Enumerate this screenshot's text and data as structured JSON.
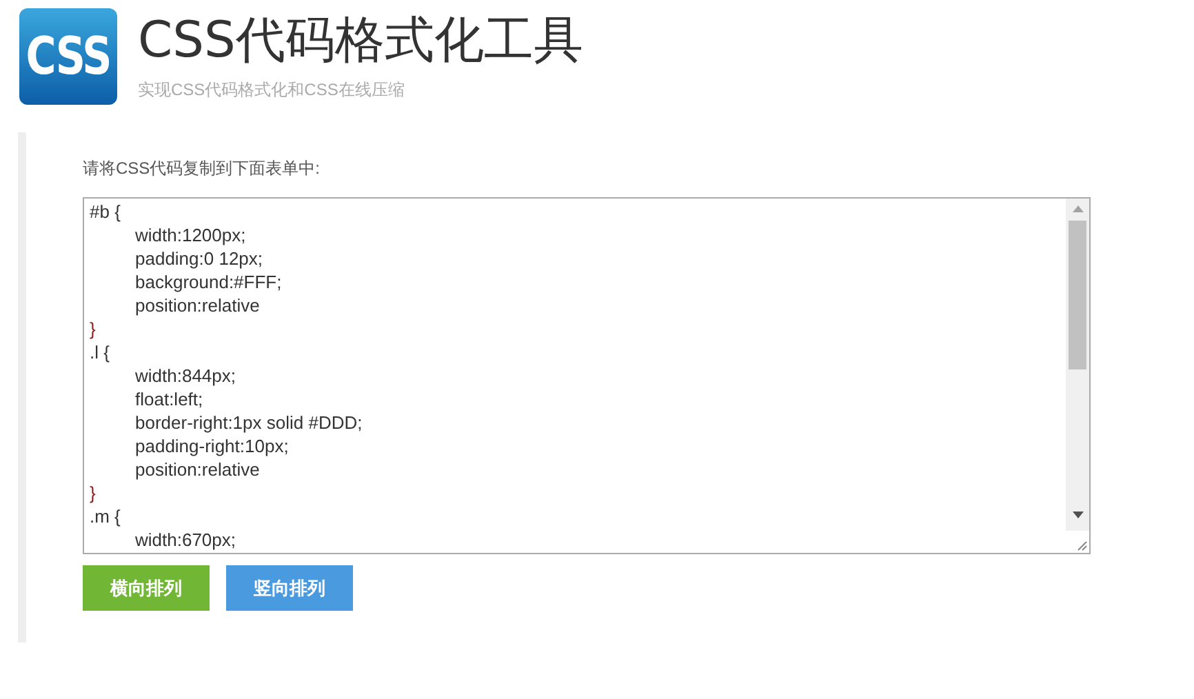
{
  "header": {
    "logo_text": "CSS",
    "title": "CSS代码格式化工具",
    "subtitle": "实现CSS代码格式化和CSS在线压缩"
  },
  "form": {
    "label": "请将CSS代码复制到下面表单中:",
    "code_lines": [
      {
        "kind": "selector",
        "text": "#b {"
      },
      {
        "kind": "property",
        "text": "width:1200px;"
      },
      {
        "kind": "property",
        "text": "padding:0 12px;"
      },
      {
        "kind": "property",
        "text": "background:#FFF;"
      },
      {
        "kind": "property",
        "text": "position:relative"
      },
      {
        "kind": "close",
        "text": "}"
      },
      {
        "kind": "selector",
        "text": ".l {"
      },
      {
        "kind": "property",
        "text": "width:844px;"
      },
      {
        "kind": "property",
        "text": "float:left;"
      },
      {
        "kind": "property",
        "text": "border-right:1px solid #DDD;"
      },
      {
        "kind": "property",
        "text": "padding-right:10px;"
      },
      {
        "kind": "property",
        "text": "position:relative"
      },
      {
        "kind": "close",
        "text": "}"
      },
      {
        "kind": "selector",
        "text": ".m {"
      },
      {
        "kind": "property",
        "text": "width:670px;"
      }
    ],
    "buttons": [
      {
        "label": "横向排列",
        "color": "#71b634"
      },
      {
        "label": "竖向排列",
        "color": "#4a9ae0"
      }
    ]
  }
}
